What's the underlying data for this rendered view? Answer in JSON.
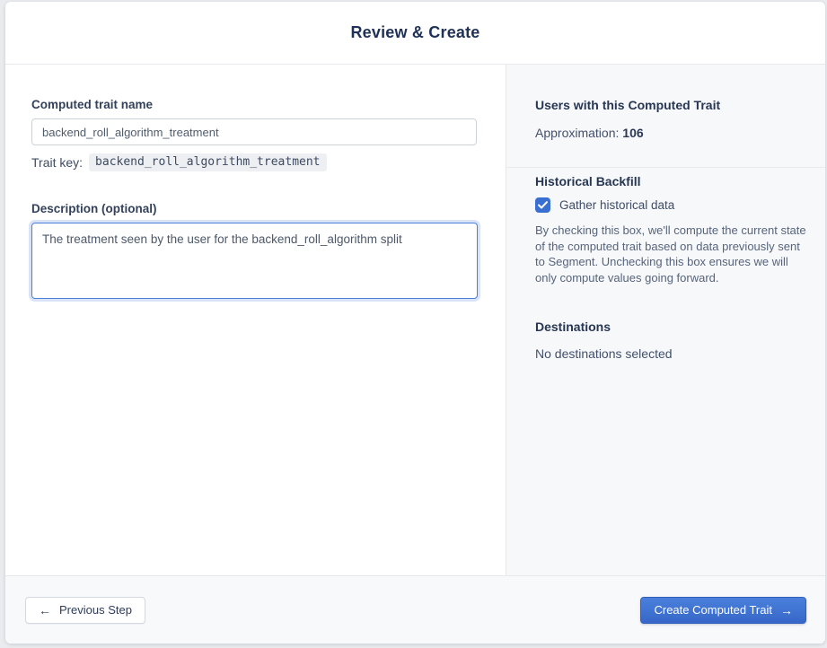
{
  "header": {
    "title": "Review & Create"
  },
  "form": {
    "name_label": "Computed trait name",
    "name_value": "backend_roll_algorithm_treatment",
    "trait_key_label": "Trait key:",
    "trait_key_value": "backend_roll_algorithm_treatment",
    "description_label": "Description (optional)",
    "description_value": "The treatment seen by the user for the backend_roll_algorithm split"
  },
  "summary": {
    "users_heading": "Users with this Computed Trait",
    "approximation_label": "Approximation:",
    "approximation_value": "106",
    "backfill_heading": "Historical Backfill",
    "backfill_checkbox_checked": "true",
    "backfill_checkbox_label": "Gather historical data",
    "backfill_description": "By checking this box, we'll compute the current state of the computed trait based on data previously sent to Segment. Unchecking this box ensures we will only compute values going forward.",
    "destinations_heading": "Destinations",
    "destinations_empty": "No destinations selected"
  },
  "footer": {
    "previous_label": "Previous Step",
    "previous_arrow": "←",
    "create_label": "Create Computed Trait",
    "create_arrow": "→"
  },
  "colors": {
    "accent_blue": "#3a6fd2",
    "primary_button_top": "#4a80dc",
    "primary_button_bottom": "#3767c9",
    "title_navy": "#1f3156",
    "right_panel_bg": "#f7f8fa"
  }
}
